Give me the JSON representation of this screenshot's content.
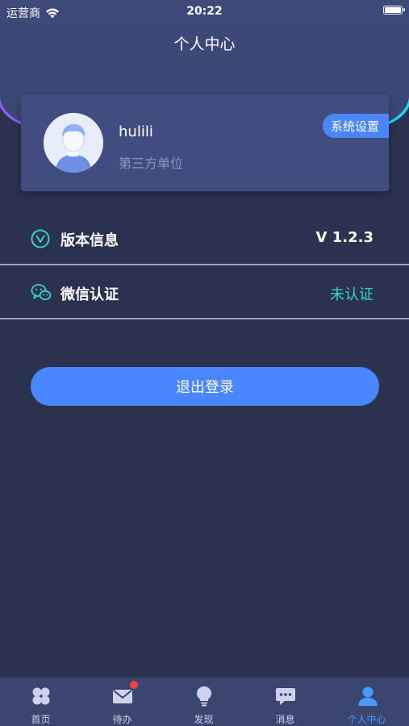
{
  "status_bar": {
    "carrier": "运营商",
    "time": "20:22"
  },
  "header": {
    "title": "个人中心"
  },
  "profile": {
    "username": "hulili",
    "organization": "第三方单位",
    "settings_label": "系统设置"
  },
  "menu": [
    {
      "label": "版本信息",
      "value": "V 1.2.3",
      "icon": "version-check-icon"
    },
    {
      "label": "微信认证",
      "value": "未认证",
      "icon": "wechat-icon"
    }
  ],
  "logout_label": "退出登录",
  "tabbar": [
    {
      "label": "首页",
      "icon": "home-grid-icon"
    },
    {
      "label": "待办",
      "icon": "mail-icon"
    },
    {
      "label": "发现",
      "icon": "lightbulb-icon"
    },
    {
      "label": "消息",
      "icon": "chat-icon"
    },
    {
      "label": "个人中心",
      "icon": "user-icon"
    }
  ],
  "colors": {
    "background": "#2a3250",
    "accent": "#4a86ff",
    "teal": "#3ad3c2",
    "active_tab": "#4a9bff",
    "badge": "#ef4444"
  }
}
